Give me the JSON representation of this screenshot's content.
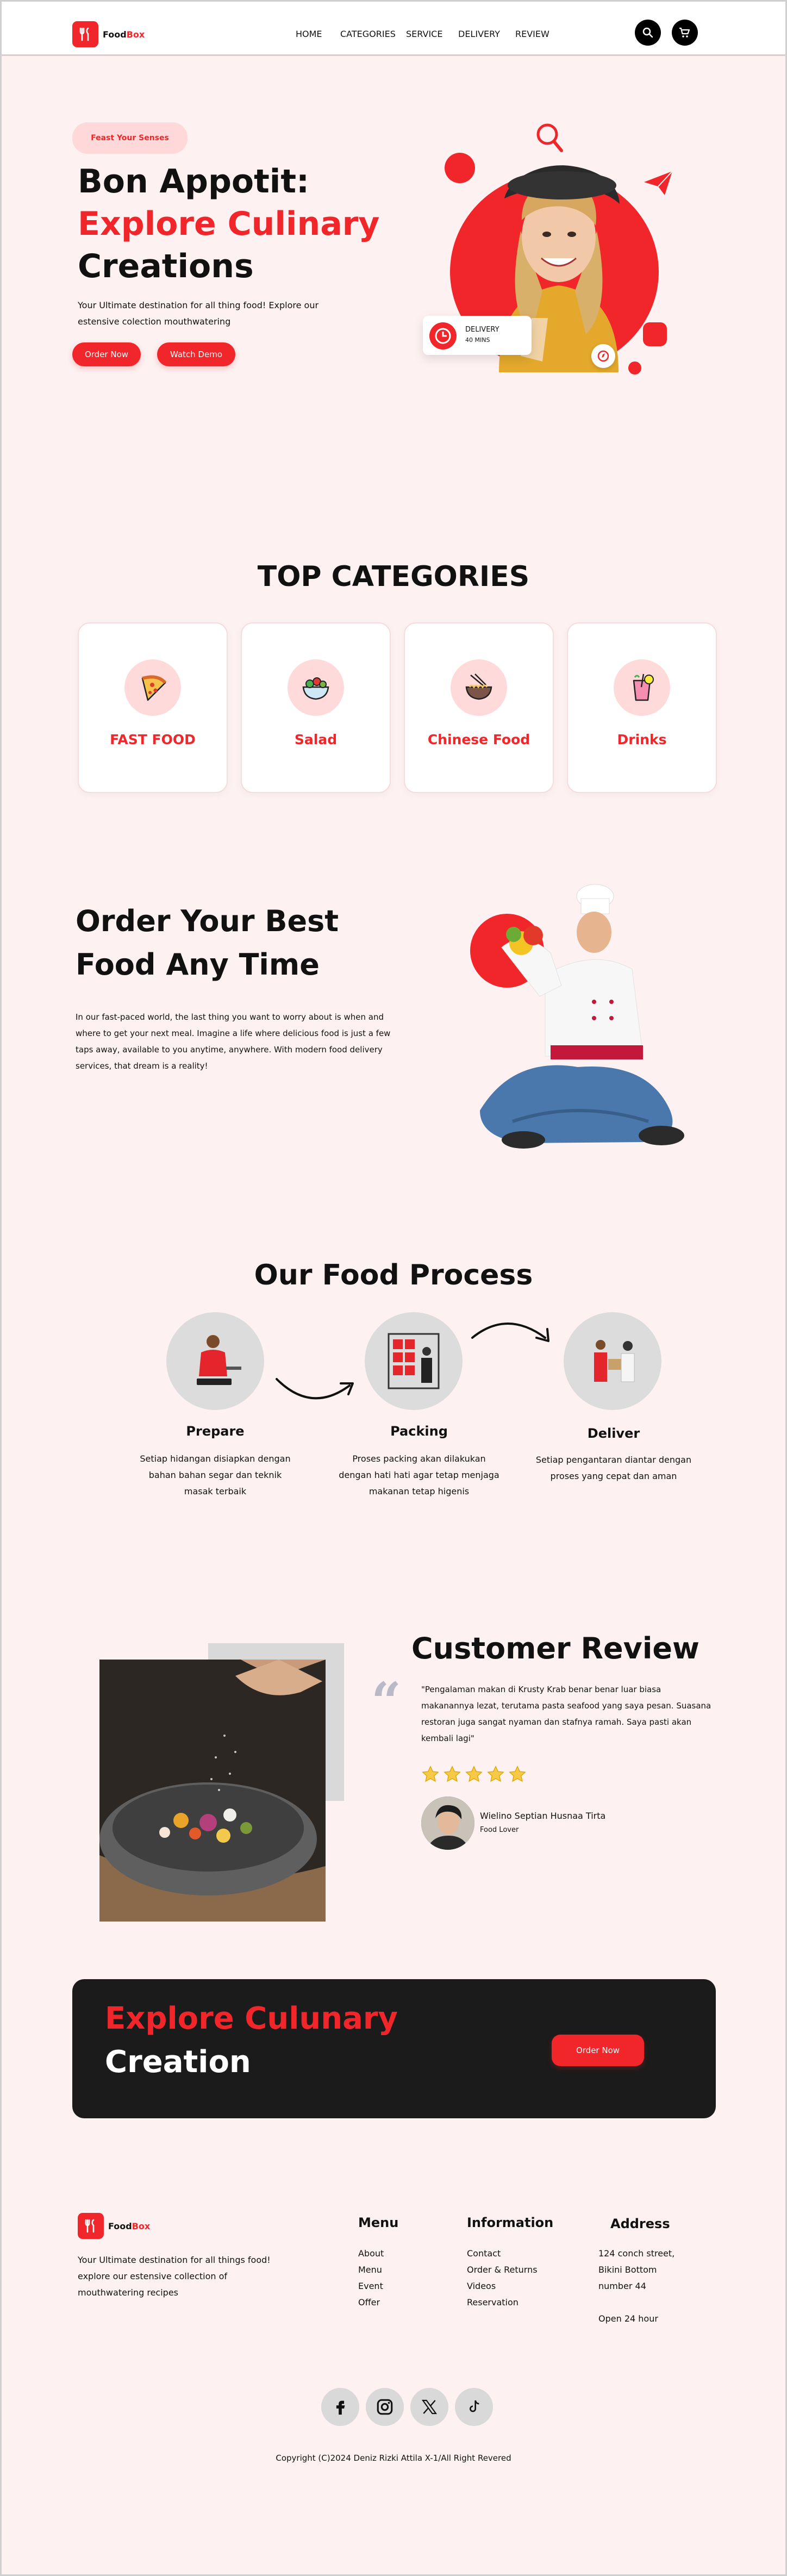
{
  "nav": {
    "brand_a": "Food",
    "brand_b": "Box",
    "links": [
      "HOME",
      "CATEGORIES",
      "SERVICE",
      "DELIVERY",
      "REVIEW"
    ]
  },
  "hero": {
    "pill": "Feast Your Senses",
    "title_line1": "Bon Appotit:",
    "title_line2": "Explore Culinary",
    "title_line3": "Creations",
    "desc": "Your Ultimate destination for all thing food! Explore our estensive colection mouthwatering",
    "btn_order": "Order Now",
    "btn_demo": "Watch Demo",
    "delivery_label": "DELIVERY",
    "delivery_time": "40 MINS"
  },
  "categories": {
    "title": "TOP CATEGORIES",
    "items": [
      {
        "name": "FAST FOOD",
        "icon": "pizza-icon"
      },
      {
        "name": "Salad",
        "icon": "salad-bowl-icon"
      },
      {
        "name": "Chinese Food",
        "icon": "noodle-bowl-icon"
      },
      {
        "name": "Drinks",
        "icon": "drink-icon"
      }
    ]
  },
  "order": {
    "title_line1": "Order Your Best",
    "title_line2": "Food Any Time",
    "desc": "In our fast-paced world, the last thing you want to worry about is when and where to get your next meal. Imagine a life where delicious food is just a few taps away, available to you anytime, anywhere. With modern food delivery services, that dream is a reality!"
  },
  "process": {
    "title": "Our Food Process",
    "steps": [
      {
        "title": "Prepare",
        "desc": "Setiap hidangan disiapkan dengan bahan bahan segar dan teknik masak terbaik"
      },
      {
        "title": "Packing",
        "desc": "Proses packing akan dilakukan dengan hati hati agar tetap menjaga makanan tetap higenis"
      },
      {
        "title": "Deliver",
        "desc": "Setiap pengantaran diantar dengan proses yang cepat dan aman"
      }
    ]
  },
  "review": {
    "title": "Customer Review",
    "quote": "\"Pengalaman makan di Krusty Krab benar benar luar biasa makanannya  lezat, terutama pasta seafood yang saya pesan. Suasana restoran juga sangat nyaman dan stafnya ramah. Saya pasti akan kembali lagi\"",
    "rating": 5,
    "reviewer_name": "Wielino Septian Husnaa Tirta",
    "reviewer_role": "Food Lover"
  },
  "cta": {
    "line1": "Explore Culunary",
    "line2": "Creation",
    "button": "Order Now"
  },
  "footer": {
    "brand_a": "Food",
    "brand_b": "Box",
    "desc": "Your Ultimate destination for all things food! explore our estensive collection of mouthwatering recipes",
    "menu_title": "Menu",
    "menu_items": [
      "About",
      "Menu",
      "Event",
      "Offer"
    ],
    "info_title": "Information",
    "info_items": [
      "Contact",
      "Order & Returns",
      "Videos",
      "Reservation"
    ],
    "address_title": "Address",
    "address_lines": [
      "124 conch street,",
      "Bikini Bottom",
      "number 44"
    ],
    "hours": "Open 24 hour",
    "socials": [
      "facebook-icon",
      "instagram-icon",
      "x-icon",
      "tiktok-icon"
    ],
    "copyright": "Copyright (C)2024 Deniz Rizki Attila X-1/All Right Revered"
  },
  "colors": {
    "accent": "#f0262b",
    "background": "#fdf1f1",
    "dark": "#1b1b1b"
  }
}
